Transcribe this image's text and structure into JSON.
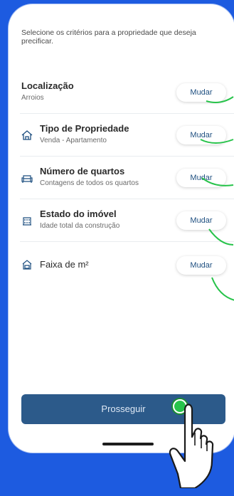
{
  "colors": {
    "background": "#1d5be0",
    "accent": "#2c5a8a",
    "highlight": "#27c34a"
  },
  "intro_text": "Selecione os critérios para a propriedade que deseja precificar.",
  "criteria": [
    {
      "title": "Localização",
      "subtitle": "Arroios",
      "icon": "",
      "button": "Mudar"
    },
    {
      "title": "Tipo de Propriedade",
      "subtitle": "Venda - Apartamento",
      "icon": "house-icon",
      "button": "Mudar"
    },
    {
      "title": "Número de quartos",
      "subtitle": "Contagens de todos os quartos",
      "icon": "sofa-icon",
      "button": "Mudar"
    },
    {
      "title": "Estado do imóvel",
      "subtitle": "Idade total da construção",
      "icon": "building-icon",
      "button": "Mudar"
    },
    {
      "title": "Faixa de m²",
      "subtitle": "",
      "icon": "area-icon",
      "button": "Mudar"
    }
  ],
  "cta_label": "Prosseguir"
}
